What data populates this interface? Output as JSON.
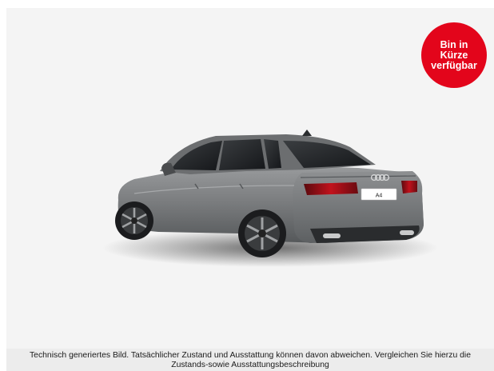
{
  "vehicle": {
    "image_icon": "car-rear-three-quarter",
    "plate_text": "A4",
    "body_color": "#7a7c7e"
  },
  "badge": {
    "text": "Bin in Kürze verfügbar",
    "color": "#e3051b"
  },
  "disclaimer": {
    "text": "Technisch generiertes Bild. Tatsächlicher Zustand und Ausstattung können davon abweichen. Vergleichen Sie hierzu die Zustands-sowie Ausstattungsbeschreibung"
  }
}
